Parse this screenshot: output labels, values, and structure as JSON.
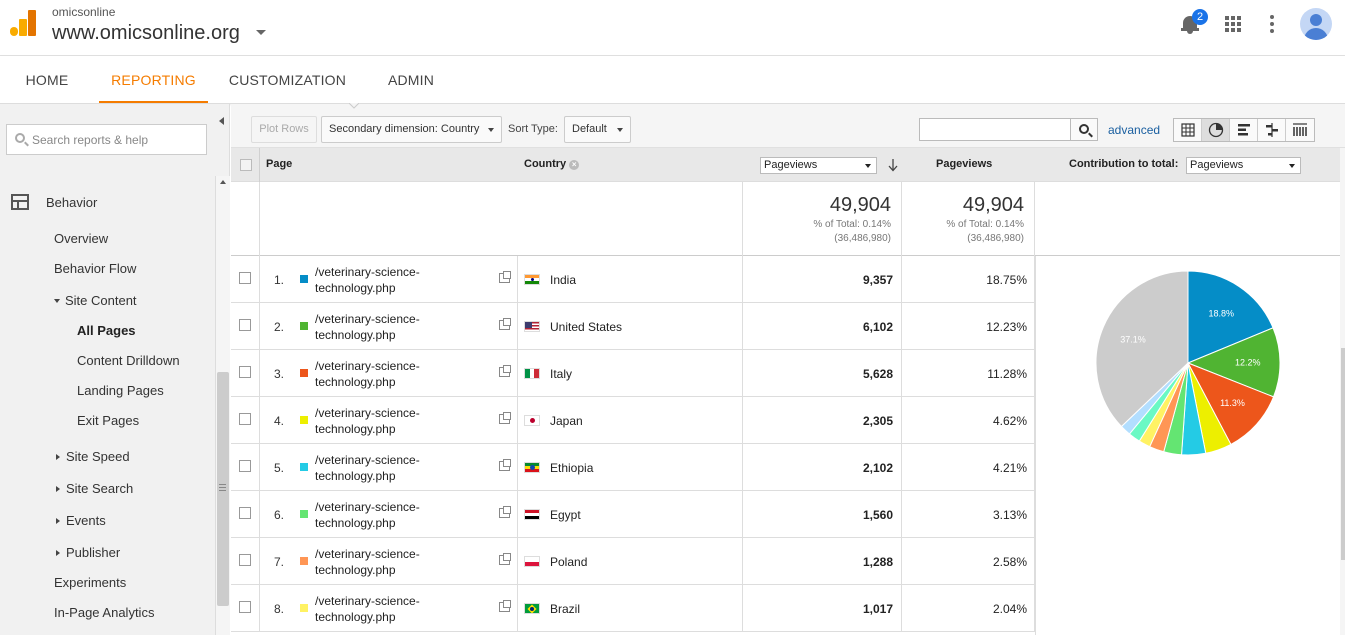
{
  "header": {
    "account_small": "omicsonline",
    "account_big": "www.omicsonline.org",
    "notification_count": "2"
  },
  "nav": {
    "tabs": [
      {
        "label": "HOME",
        "active": false
      },
      {
        "label": "REPORTING",
        "active": true
      },
      {
        "label": "CUSTOMIZATION",
        "active": false
      },
      {
        "label": "ADMIN",
        "active": false
      }
    ]
  },
  "sidebar": {
    "search_placeholder": "Search reports & help",
    "section": "Behavior",
    "items": [
      {
        "label": "Overview"
      },
      {
        "label": "Behavior Flow"
      },
      {
        "label": "Site Content"
      },
      {
        "label": "All Pages"
      },
      {
        "label": "Content Drilldown"
      },
      {
        "label": "Landing Pages"
      },
      {
        "label": "Exit Pages"
      },
      {
        "label": "Site Speed"
      },
      {
        "label": "Site Search"
      },
      {
        "label": "Events"
      },
      {
        "label": "Publisher"
      },
      {
        "label": "Experiments"
      },
      {
        "label": "In-Page Analytics"
      }
    ]
  },
  "toolbar": {
    "plot_rows": "Plot Rows",
    "secondary_dimension": "Secondary dimension: Country",
    "sort_type_label": "Sort Type:",
    "sort_type_value": "Default",
    "search_value": "",
    "advanced": "advanced"
  },
  "table": {
    "col_page": "Page",
    "col_country": "Country",
    "metric_select": "Pageviews",
    "col_pageviews": "Pageviews",
    "contribution_label": "Contribution to total:",
    "contribution_select": "Pageviews",
    "summary": {
      "total": "49,904",
      "pct_of_total": "% of Total: 0.14%",
      "grand_total": "(36,486,980)"
    },
    "rows": [
      {
        "num": "1.",
        "page": "/veterinary-science-technology.php",
        "country": "India",
        "pageviews": "9,357",
        "pct": "18.75%",
        "color": "#058dc7"
      },
      {
        "num": "2.",
        "page": "/veterinary-science-technology.php",
        "country": "United States",
        "pageviews": "6,102",
        "pct": "12.23%",
        "color": "#50b432"
      },
      {
        "num": "3.",
        "page": "/veterinary-science-technology.php",
        "country": "Italy",
        "pageviews": "5,628",
        "pct": "11.28%",
        "color": "#ed561b"
      },
      {
        "num": "4.",
        "page": "/veterinary-science-technology.php",
        "country": "Japan",
        "pageviews": "2,305",
        "pct": "4.62%",
        "color": "#edef00"
      },
      {
        "num": "5.",
        "page": "/veterinary-science-technology.php",
        "country": "Ethiopia",
        "pageviews": "2,102",
        "pct": "4.21%",
        "color": "#24cbe5"
      },
      {
        "num": "6.",
        "page": "/veterinary-science-technology.php",
        "country": "Egypt",
        "pageviews": "1,560",
        "pct": "3.13%",
        "color": "#64e572"
      },
      {
        "num": "7.",
        "page": "/veterinary-science-technology.php",
        "country": "Poland",
        "pageviews": "1,288",
        "pct": "2.58%",
        "color": "#ff9655"
      },
      {
        "num": "8.",
        "page": "/veterinary-science-technology.php",
        "country": "Brazil",
        "pageviews": "1,017",
        "pct": "2.04%",
        "color": "#fff263"
      }
    ]
  },
  "chart_data": {
    "type": "pie",
    "slices": [
      {
        "value": 18.75,
        "color": "#058dc7",
        "label": "18.8%"
      },
      {
        "value": 12.23,
        "color": "#50b432",
        "label": "12.2%"
      },
      {
        "value": 11.28,
        "color": "#ed561b",
        "label": "11.3%"
      },
      {
        "value": 4.62,
        "color": "#edef00",
        "label": ""
      },
      {
        "value": 4.21,
        "color": "#24cbe5",
        "label": ""
      },
      {
        "value": 3.13,
        "color": "#64e572",
        "label": ""
      },
      {
        "value": 2.58,
        "color": "#ff9655",
        "label": ""
      },
      {
        "value": 2.04,
        "color": "#fff263",
        "label": ""
      },
      {
        "value": 2.1,
        "color": "#6af9c4",
        "label": ""
      },
      {
        "value": 1.9,
        "color": "#b2deff",
        "label": ""
      },
      {
        "value": 37.1,
        "color": "#cccccc",
        "label": "37.1%"
      }
    ]
  }
}
